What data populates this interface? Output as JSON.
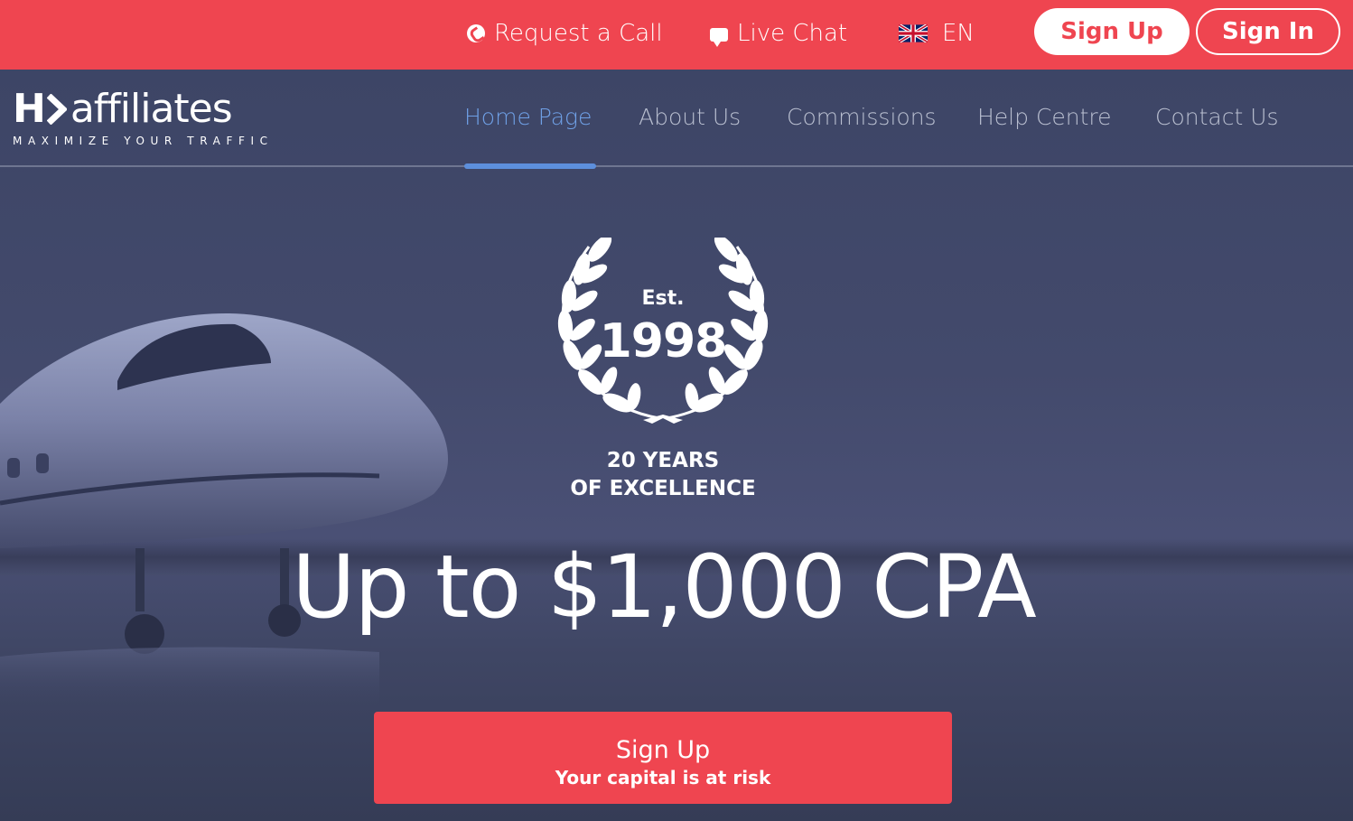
{
  "topbar": {
    "request_call": "Request a Call",
    "live_chat": "Live Chat",
    "language": "EN",
    "sign_up": "Sign Up",
    "sign_in": "Sign In",
    "icons": [
      "phone-icon",
      "chat-icon",
      "uk-flag-icon"
    ]
  },
  "brand": {
    "logo_hy": "H",
    "logo_name": "affiliates",
    "tagline": "MAXIMIZE YOUR TRAFFIC"
  },
  "nav": {
    "items": [
      {
        "label": "Home Page",
        "active": true
      },
      {
        "label": "About Us"
      },
      {
        "label": "Commissions"
      },
      {
        "label": "Help Centre"
      },
      {
        "label": "Contact Us"
      }
    ]
  },
  "hero": {
    "est": "Est.",
    "year": "1998",
    "years_line1": "20 YEARS",
    "years_line2": "OF EXCELLENCE",
    "headline": "Up to $1,000 CPA",
    "cta_label": "Sign Up",
    "cta_sub": "Your capital is at risk"
  },
  "colors": {
    "accent": "#ef4550",
    "nav_active": "#6fa0e6",
    "hero_bg": "#3c4462"
  }
}
